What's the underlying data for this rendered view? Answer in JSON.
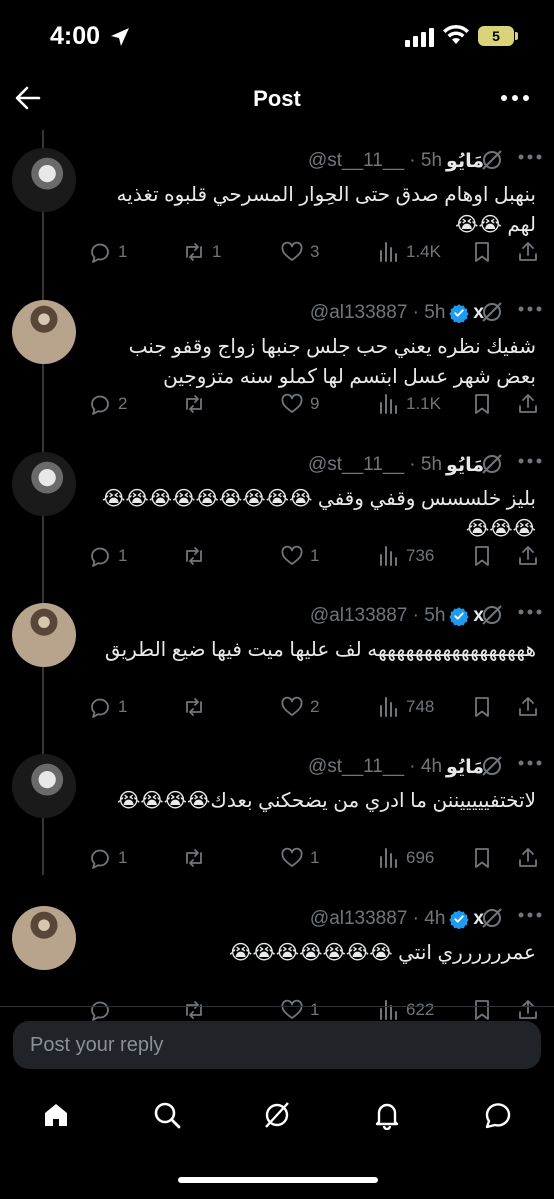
{
  "status_bar": {
    "time": "4:00",
    "battery": "5"
  },
  "header": {
    "title": "Post"
  },
  "tweets": [
    {
      "name": "مَايُو",
      "handle": "@st__11__",
      "time": "5h",
      "verified": false,
      "text": "بنهبل اوهام صدق حتى الحِوار المسرحي قلبوه تغذيه لهم 😭😭",
      "replies": "1",
      "reposts": "1",
      "likes": "3",
      "views": "1.4K"
    },
    {
      "name": "x",
      "handle": "@al133887",
      "time": "5h",
      "verified": true,
      "text": "شفيك نظره يعني حب جلس جنبها زواج وقفو جنب بعض شهر عسل ابتسم لها كملو سنه متزوجين",
      "replies": "2",
      "reposts": "",
      "likes": "9",
      "views": "1.1K"
    },
    {
      "name": "مَايُو",
      "handle": "@st__11__",
      "time": "5h",
      "verified": false,
      "text": "بليز خلسسس وقفي وقفي 😭😭😭😭😭😭😭😭😭😭😭😭",
      "replies": "1",
      "reposts": "",
      "likes": "1",
      "views": "736"
    },
    {
      "name": "x",
      "handle": "@al133887",
      "time": "5h",
      "verified": true,
      "text": "هههههههههههههههههه لف عليها ميت فيها ضيع الطريق",
      "replies": "1",
      "reposts": "",
      "likes": "2",
      "views": "748"
    },
    {
      "name": "مَايُو",
      "handle": "@st__11__",
      "time": "4h",
      "verified": false,
      "text": "لاتختفيييييننن ما ادري من يضحكني بعدك😭😭😭😭",
      "replies": "1",
      "reposts": "",
      "likes": "1",
      "views": "696"
    },
    {
      "name": "x",
      "handle": "@al133887",
      "time": "4h",
      "verified": true,
      "text": "عمرررررري انتي 😭😭😭😭😭😭😭",
      "replies": "",
      "reposts": "",
      "likes": "1",
      "views": "622"
    }
  ],
  "reply": {
    "placeholder": "Post your reply"
  },
  "colors": {
    "background": "#000000",
    "text": "#e7e9ea",
    "muted": "#71767b",
    "verified": "#1d9bf0",
    "battery": "#d9d37a"
  },
  "icons": [
    "back-arrow-icon",
    "more-icon",
    "grok-icon",
    "verified-badge-icon",
    "reply-icon",
    "repost-icon",
    "like-icon",
    "views-icon",
    "bookmark-icon",
    "share-icon",
    "home-icon",
    "search-icon",
    "grok-icon",
    "notifications-icon",
    "messages-icon"
  ]
}
